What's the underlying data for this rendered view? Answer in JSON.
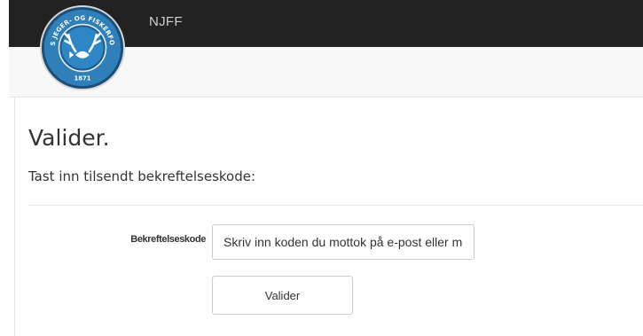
{
  "header": {
    "brand": "NJFF",
    "logo": {
      "text_top": "NORGES JEGER- OG FISKERFORBUND",
      "year": "1871",
      "icon": "njff-logo-icon",
      "colors": {
        "ring": "#1f5a8a",
        "outer": "#2f7fb8",
        "inner": "#2e87c4"
      }
    }
  },
  "main": {
    "title": "Valider.",
    "subtitle": "Tast inn tilsendt bekreftelseskode:",
    "form": {
      "code_label": "Bekreftelseskode",
      "code_placeholder": "Skriv inn koden du mottok på e-post eller mobil",
      "code_value": "",
      "submit_label": "Valider"
    }
  },
  "colors": {
    "topbar": "#222222",
    "subbar": "#f8f8f8",
    "text": "#333333"
  }
}
